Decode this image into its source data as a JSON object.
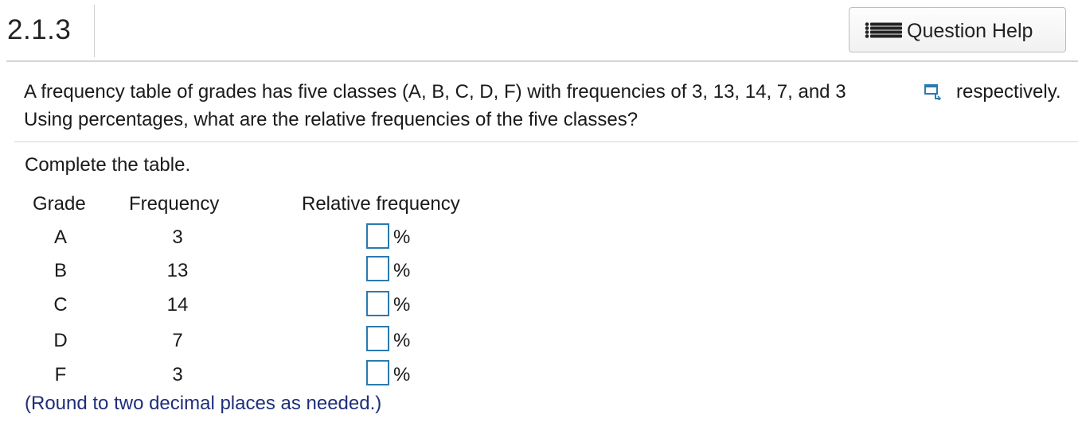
{
  "header": {
    "question_number": "2.1.3",
    "help_button_label": "Question Help",
    "help_icon": "list-icon"
  },
  "question": {
    "line1": "A frequency table of grades has five classes (A, B, C, D, F) with frequencies of 3, 13, 14, 7, and 3",
    "copy_icon": "copy-data-icon",
    "line1_end": "respectively.",
    "line2": "Using percentages, what are the relative frequencies of the five classes?"
  },
  "instruction": "Complete the table.",
  "table": {
    "headers": [
      "Grade",
      "Frequency",
      "Relative frequency"
    ],
    "rows": [
      {
        "grade": "A",
        "frequency": "3",
        "relative_frequency": "",
        "unit": "%"
      },
      {
        "grade": "B",
        "frequency": "13",
        "relative_frequency": "",
        "unit": "%"
      },
      {
        "grade": "C",
        "frequency": "14",
        "relative_frequency": "",
        "unit": "%"
      },
      {
        "grade": "D",
        "frequency": "7",
        "relative_frequency": "",
        "unit": "%"
      },
      {
        "grade": "F",
        "frequency": "3",
        "relative_frequency": "",
        "unit": "%"
      }
    ]
  },
  "note": "(Round to two decimal places as needed.)",
  "colors": {
    "answer_box_border": "#2a7ab0",
    "note_text": "#1f2e7a"
  }
}
